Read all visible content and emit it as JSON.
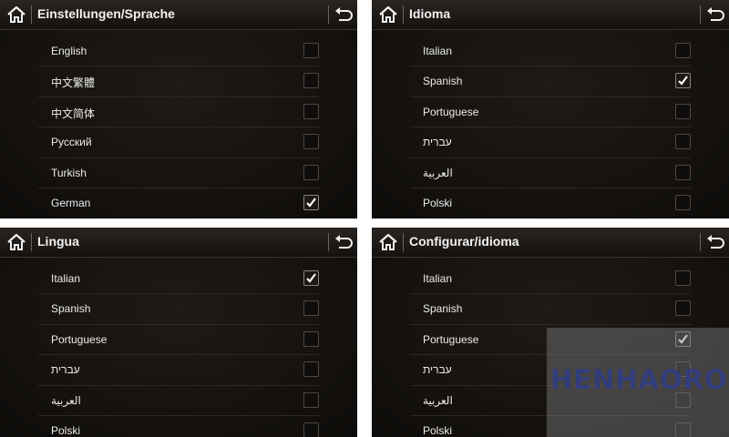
{
  "panels": [
    {
      "title": "Einstellungen/Sprache",
      "items": [
        {
          "label": "English",
          "checked": false
        },
        {
          "label": "中文繁體",
          "checked": false
        },
        {
          "label": "中文简体",
          "checked": false
        },
        {
          "label": "Русский",
          "checked": false
        },
        {
          "label": "Turkish",
          "checked": false
        },
        {
          "label": "German",
          "checked": true
        }
      ]
    },
    {
      "title": "Idioma",
      "items": [
        {
          "label": "Italian",
          "checked": false
        },
        {
          "label": "Spanish",
          "checked": true
        },
        {
          "label": "Portuguese",
          "checked": false
        },
        {
          "label": "עברית",
          "checked": false
        },
        {
          "label": "العربية",
          "checked": false
        },
        {
          "label": "Polski",
          "checked": false
        }
      ]
    },
    {
      "title": "Lingua",
      "items": [
        {
          "label": "Italian",
          "checked": true
        },
        {
          "label": "Spanish",
          "checked": false
        },
        {
          "label": "Portuguese",
          "checked": false
        },
        {
          "label": "עברית",
          "checked": false
        },
        {
          "label": "العربية",
          "checked": false
        },
        {
          "label": "Polski",
          "checked": false
        }
      ]
    },
    {
      "title": "Configurar/idioma",
      "items": [
        {
          "label": "Italian",
          "checked": false
        },
        {
          "label": "Spanish",
          "checked": false
        },
        {
          "label": "Portuguese",
          "checked": true
        },
        {
          "label": "עברית",
          "checked": false
        },
        {
          "label": "العربية",
          "checked": false
        },
        {
          "label": "Polski",
          "checked": false
        }
      ]
    }
  ],
  "icons": {
    "home": "home-icon",
    "back": "back-arrow-icon",
    "check": "checkmark-icon"
  },
  "watermark": "HENHAORO",
  "colors": {
    "background": "#15120f",
    "text": "#ececec",
    "watermark": "#2f3c86"
  }
}
